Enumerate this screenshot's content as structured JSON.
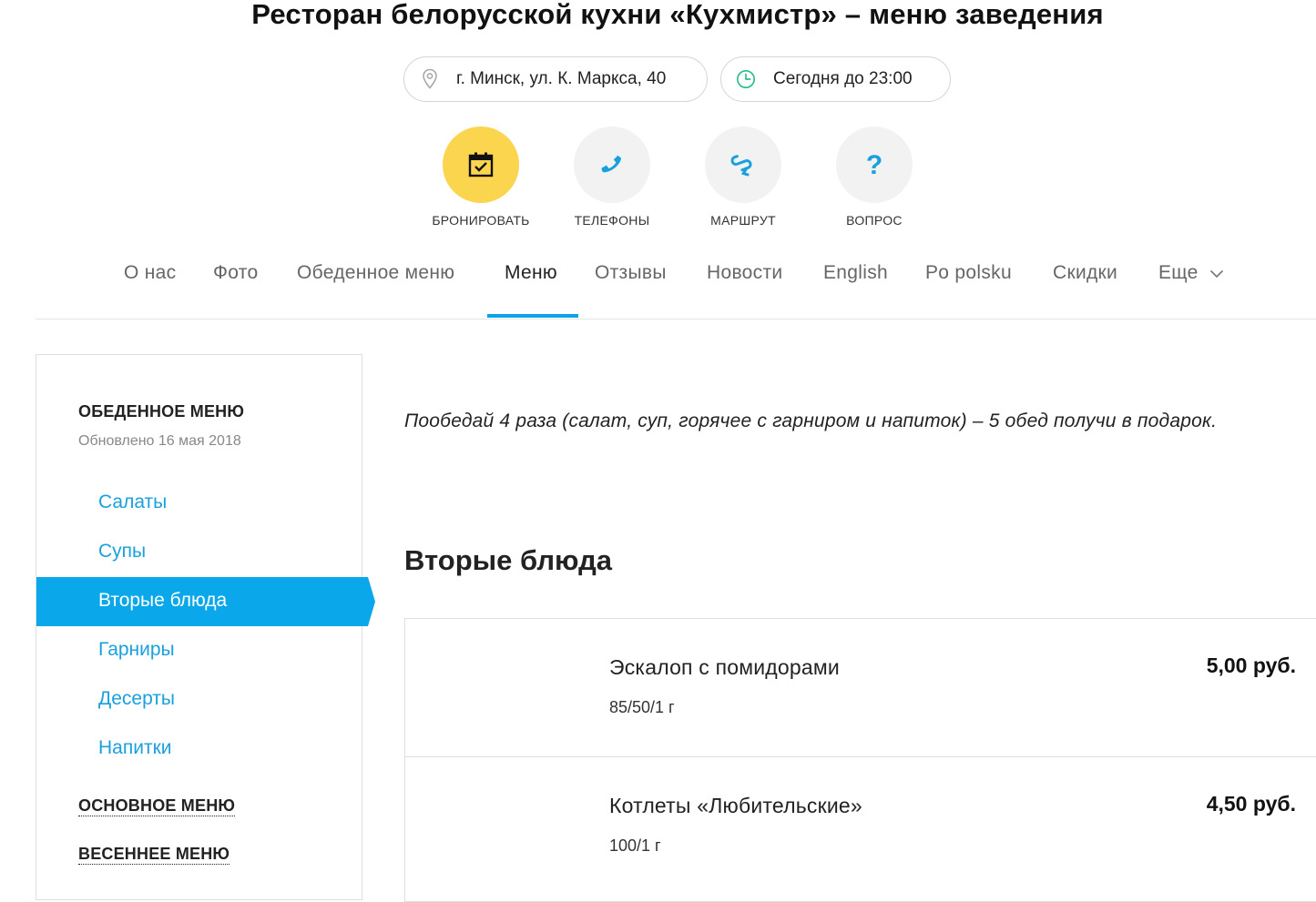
{
  "page": {
    "title": "Ресторан белорусской кухни «Кухмистр» – меню заведения"
  },
  "info": {
    "address": "г. Минск, ул. К. Маркса, 40",
    "hours": "Сегодня до 23:00",
    "address_icon": "location-pin-icon",
    "hours_icon": "clock-icon"
  },
  "actions": [
    {
      "label": "БРОНИРОВАТЬ",
      "icon": "calendar-check-icon"
    },
    {
      "label": "ТЕЛЕФОНЫ",
      "icon": "phone-icon"
    },
    {
      "label": "МАРШРУТ",
      "icon": "route-icon"
    },
    {
      "label": "ВОПРОС",
      "icon": "question-icon"
    }
  ],
  "tabs": [
    {
      "label": "О нас"
    },
    {
      "label": "Фото"
    },
    {
      "label": "Обеденное меню"
    },
    {
      "label": "Меню",
      "active": true
    },
    {
      "label": "Отзывы"
    },
    {
      "label": "Новости"
    },
    {
      "label": "English"
    },
    {
      "label": "Po polsku"
    },
    {
      "label": "Скидки"
    },
    {
      "label": "Еще"
    }
  ],
  "sidebar": {
    "current_menu_title": "ОБЕДЕННОЕ МЕНЮ",
    "updated": "Обновлено 16 мая 2018",
    "categories": [
      "Салаты",
      "Супы",
      "Вторые блюда",
      "Гарниры",
      "Десерты",
      "Напитки"
    ],
    "active_category": "Вторые блюда",
    "other_menus": [
      "ОСНОВНОЕ МЕНЮ",
      "ВЕСЕННЕЕ МЕНЮ"
    ]
  },
  "content": {
    "promo": "Пообедай 4 раза (салат, суп, горячее с гарниром и напиток) – 5 обед получи в подарок.",
    "section_title": "Вторые блюда",
    "dishes": [
      {
        "name": "Эскалоп с помидорами",
        "weight": "85/50/1 г",
        "price": "5,00 руб."
      },
      {
        "name": "Котлеты «Любительские»",
        "weight": "100/1 г",
        "price": "4,50 руб."
      }
    ]
  },
  "colors": {
    "accent": "#0aa8ea",
    "booking": "#fbd54e",
    "link": "#1aa0dc",
    "clock": "#2dbd8a"
  }
}
